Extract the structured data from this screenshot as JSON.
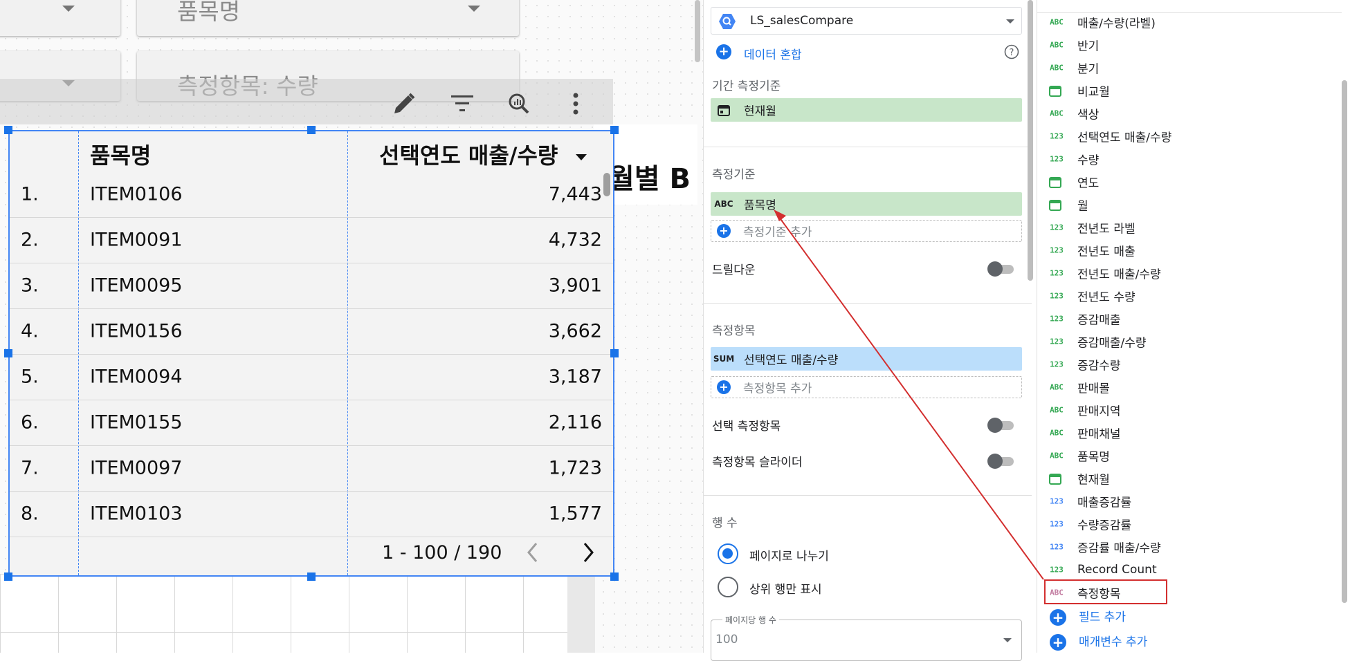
{
  "canvas": {
    "controls": {
      "top_right_label": "품목명",
      "metric_label": "측정항목: 수량"
    },
    "background_chart_title_partial": "월별 B"
  },
  "table": {
    "headers": {
      "dimension": "품목명",
      "metric": "선택연도 매출/수량"
    },
    "rows": [
      {
        "idx": "1.",
        "name": "ITEM0106",
        "value": "7,443"
      },
      {
        "idx": "2.",
        "name": "ITEM0091",
        "value": "4,732"
      },
      {
        "idx": "3.",
        "name": "ITEM0095",
        "value": "3,901"
      },
      {
        "idx": "4.",
        "name": "ITEM0156",
        "value": "3,662"
      },
      {
        "idx": "5.",
        "name": "ITEM0094",
        "value": "3,187"
      },
      {
        "idx": "6.",
        "name": "ITEM0155",
        "value": "2,116"
      },
      {
        "idx": "7.",
        "name": "ITEM0097",
        "value": "1,723"
      },
      {
        "idx": "8.",
        "name": "ITEM0103",
        "value": "1,577"
      }
    ],
    "pagination": "1 - 100 / 190"
  },
  "setup": {
    "datasource": "LS_salesCompare",
    "blend_label": "데이터 혼합",
    "date_range_dimension_label": "기간 측정기준",
    "date_range_dimension_value": "현재월",
    "dimension_label": "측정기준",
    "dimension_value": "품목명",
    "add_dimension": "측정기준 추가",
    "drilldown_label": "드릴다운",
    "metric_label": "측정항목",
    "metric_agg": "SUM",
    "metric_value": "선택연도 매출/수량",
    "add_metric": "측정항목 추가",
    "optional_metrics_label": "선택 측정항목",
    "metric_slider_label": "측정항목 슬라이더",
    "rows_label": "행 수",
    "paginate_label": "페이지로 나누기",
    "top_rows_label": "상위 행만 표시",
    "rows_per_page_label": "페이지당 행 수",
    "rows_per_page_value": "100",
    "abc_tag": "ABC"
  },
  "fields": [
    {
      "type": "ABC",
      "name": "매출/수량(라벨)"
    },
    {
      "type": "ABC",
      "name": "반기"
    },
    {
      "type": "ABC",
      "name": "분기"
    },
    {
      "type": "date",
      "name": "비교월"
    },
    {
      "type": "ABC",
      "name": "색상"
    },
    {
      "type": "123",
      "name": "선택연도 매출/수량"
    },
    {
      "type": "123",
      "name": "수량"
    },
    {
      "type": "date",
      "name": "연도"
    },
    {
      "type": "date",
      "name": "월"
    },
    {
      "type": "123",
      "name": "전년도 라벨"
    },
    {
      "type": "123",
      "name": "전년도 매출"
    },
    {
      "type": "123",
      "name": "전년도 매출/수량"
    },
    {
      "type": "123",
      "name": "전년도 수량"
    },
    {
      "type": "123",
      "name": "증감매출"
    },
    {
      "type": "123",
      "name": "증감매출/수량"
    },
    {
      "type": "123",
      "name": "증감수량"
    },
    {
      "type": "ABC",
      "name": "판매몰"
    },
    {
      "type": "ABC",
      "name": "판매지역"
    },
    {
      "type": "ABC",
      "name": "판매채널"
    },
    {
      "type": "ABC",
      "name": "품목명"
    },
    {
      "type": "date",
      "name": "현재월"
    },
    {
      "type": "123b",
      "name": "매출증감률"
    },
    {
      "type": "123b",
      "name": "수량증감률"
    },
    {
      "type": "123b",
      "name": "증감률 매출/수량"
    },
    {
      "type": "123",
      "name": "Record Count"
    },
    {
      "type": "ABCp",
      "name": "측정항목"
    }
  ],
  "field_actions": {
    "add_field": "필드 추가",
    "add_parameter": "매개변수 추가"
  },
  "colors": {
    "accent": "#1a73e8",
    "dimension_chip": "#c8e6c9",
    "metric_chip": "#bbdefb",
    "highlight_box": "#d32f2f",
    "arrow": "#d32f2f"
  }
}
